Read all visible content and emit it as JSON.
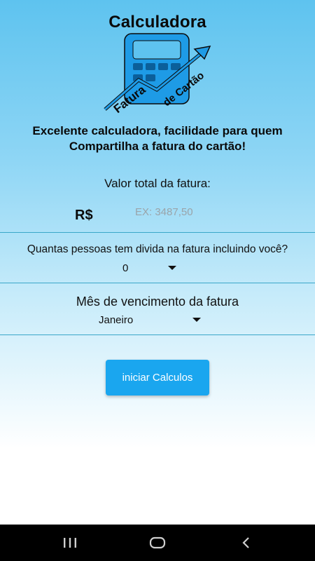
{
  "logo": {
    "title": "Calculadora",
    "word1": "Fatura",
    "word2": "de Cartão",
    "icon": "calculator-chart-icon"
  },
  "tagline": "Excelente calculadora, facilidade para quem Compartilha a fatura do cartão!",
  "invoice_total": {
    "label": "Valor total da fatura:",
    "currency": "R$",
    "value": "",
    "placeholder": "EX: 3487,50"
  },
  "people": {
    "label": "Quantas pessoas tem divida na fatura incluindo você?",
    "selected": "0"
  },
  "due_month": {
    "label": "Mês de vencimento da fatura",
    "selected": "Janeiro"
  },
  "calculate_button": {
    "label": "iniciar Calculos"
  },
  "navbar": {
    "icons": [
      "recent-apps-icon",
      "home-icon",
      "back-icon"
    ]
  },
  "colors": {
    "accent": "#1aa6ef",
    "background_top": "#5ec3ef",
    "divider": "#3aa7c9"
  }
}
